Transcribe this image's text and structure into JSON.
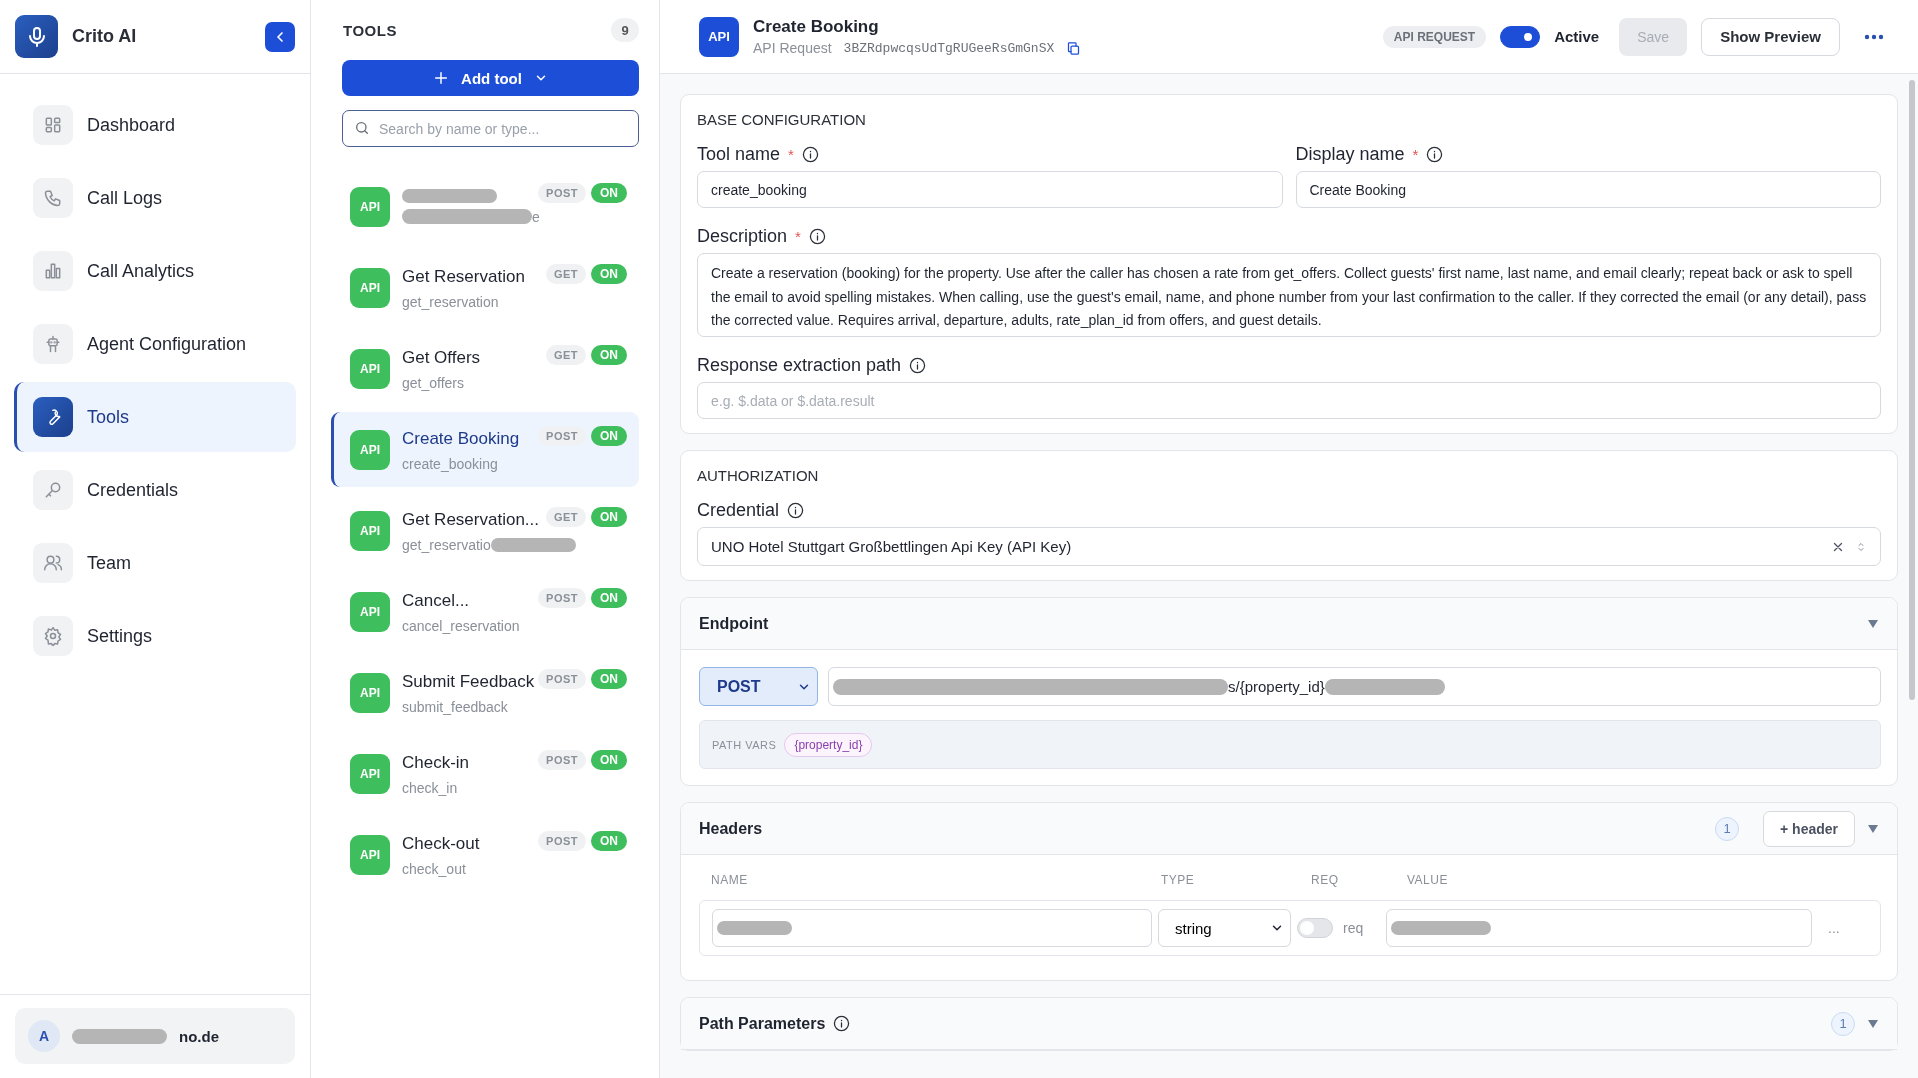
{
  "app": {
    "name": "Crito AI"
  },
  "nav": [
    {
      "label": "Dashboard",
      "selected": false
    },
    {
      "label": "Call Logs",
      "selected": false
    },
    {
      "label": "Call Analytics",
      "selected": false
    },
    {
      "label": "Agent Configuration",
      "selected": false
    },
    {
      "label": "Tools",
      "selected": true
    },
    {
      "label": "Credentials",
      "selected": false
    },
    {
      "label": "Team",
      "selected": false
    },
    {
      "label": "Settings",
      "selected": false
    }
  ],
  "user": {
    "avatar": "A",
    "email_tail": "no.de"
  },
  "tools_panel": {
    "title": "TOOLS",
    "count": "9",
    "add_button": "Add tool",
    "search_placeholder": "Search by name or type...",
    "items": [
      {
        "badge": "API",
        "name_redacted": true,
        "slug": "e",
        "slug_redacted_before": true,
        "method": "POST",
        "status": "ON",
        "on": true,
        "selected": false
      },
      {
        "badge": "API",
        "name": "Get Reservation",
        "slug": "get_reservation",
        "method": "GET",
        "status": "ON",
        "on": true,
        "selected": false
      },
      {
        "badge": "API",
        "name": "Get Offers",
        "slug": "get_offers",
        "method": "GET",
        "status": "ON",
        "on": true,
        "selected": false
      },
      {
        "badge": "API",
        "name": "Create Booking",
        "slug": "create_booking",
        "method": "POST",
        "status": "ON",
        "on": true,
        "selected": true
      },
      {
        "badge": "API",
        "name": "Get Reservation...",
        "slug": "get_reservatio",
        "slug_redacted_after": true,
        "method": "GET",
        "status": "ON",
        "on": true,
        "selected": false
      },
      {
        "badge": "API",
        "name": "Cancel...",
        "slug": "cancel_reservation",
        "method": "POST",
        "status": "ON",
        "on": true,
        "selected": false
      },
      {
        "badge": "API",
        "name": "Submit Feedback",
        "slug": "submit_feedback",
        "method": "POST",
        "status": "ON",
        "on": true,
        "selected": false
      },
      {
        "badge": "API",
        "name": "Check-in",
        "slug": "check_in",
        "method": "POST",
        "status": "ON",
        "on": true,
        "selected": false
      },
      {
        "badge": "API",
        "name": "Check-out",
        "slug": "check_out",
        "method": "POST",
        "status": "ON",
        "on": true,
        "selected": false
      }
    ]
  },
  "header": {
    "badge": "API",
    "title": "Create Booking",
    "subtitle": "API Request",
    "id": "3BZRdpwcqsUdTgRUGeeRsGmGnSX",
    "type_badge": "API REQUEST",
    "active": true,
    "active_label": "Active",
    "save": {
      "label": "Save",
      "disabled": true
    },
    "preview": "Show Preview"
  },
  "base_config": {
    "heading": "BASE CONFIGURATION",
    "tool_name": {
      "label": "Tool name",
      "required_mark": "*",
      "value": "create_booking"
    },
    "display_name": {
      "label": "Display name",
      "required_mark": "*",
      "value": "Create Booking"
    },
    "description": {
      "label": "Description",
      "required_mark": "*",
      "value": "Create a reservation (booking) for the property. Use after the caller has chosen a rate from get_offers. Collect guests' first name, last name, and email clearly; repeat back or ask to spell the email to avoid spelling mistakes. When calling, use the guest's email, name, and phone number from your last confirmation to the caller. If they corrected the email (or any detail), pass the corrected value. Requires arrival, departure, adults, rate_plan_id from offers, and guest details."
    },
    "response_path": {
      "label": "Response extraction path",
      "placeholder": "e.g. $.data or $.data.result"
    }
  },
  "authorization": {
    "heading": "AUTHORIZATION",
    "label": "Credential",
    "value": "UNO Hotel Stuttgart Großbettlingen Api Key (API Key)"
  },
  "endpoint": {
    "title": "Endpoint",
    "expanded": true,
    "method": "POST",
    "url_visible": "s/{property_id}",
    "path_vars_label": "PATH VARS",
    "path_vars": [
      "{property_id}"
    ]
  },
  "headers": {
    "title": "Headers",
    "count": "1",
    "add_button": "+ header",
    "expanded": true,
    "columns": [
      "NAME",
      "TYPE",
      "REQ",
      "VALUE"
    ],
    "rows": [
      {
        "type": "string",
        "required": false,
        "req_label": "req",
        "more": "..."
      }
    ]
  },
  "path_parameters": {
    "title": "Path Parameters",
    "count": "1",
    "expanded": true
  }
}
